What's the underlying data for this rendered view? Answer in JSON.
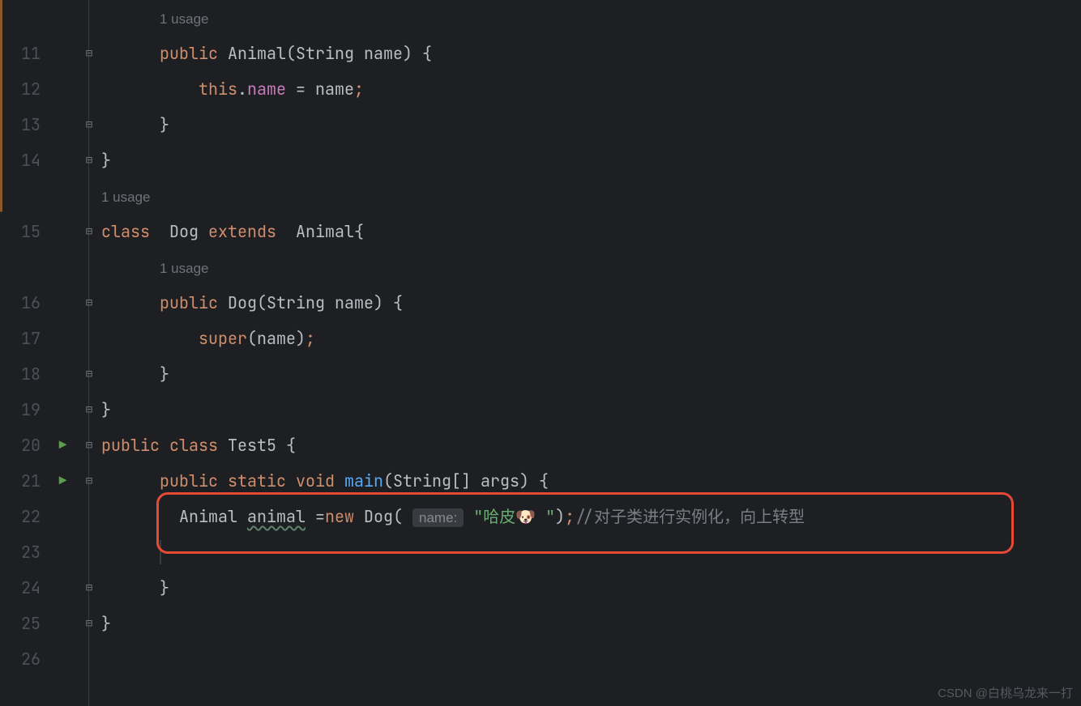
{
  "gutter": {
    "line_numbers": [
      "",
      "11",
      "12",
      "13",
      "14",
      "",
      "15",
      "",
      "16",
      "17",
      "18",
      "19",
      "20",
      "21",
      "22",
      "23",
      "24",
      "25",
      "26"
    ],
    "run_markers": {
      "12": "run",
      "13": "run"
    }
  },
  "hints": {
    "usage_animal_ctor": "1 usage",
    "usage_dog_class": "1 usage",
    "usage_dog_ctor": "1 usage",
    "param_name": "name:"
  },
  "code": {
    "kw_public": "public",
    "kw_class": "class",
    "kw_extends": "extends",
    "kw_static": "static",
    "kw_void": "void",
    "kw_this": "this",
    "kw_super": "super",
    "kw_new": "new",
    "type_animal": "Animal",
    "type_dog": "Dog",
    "type_string": "String",
    "type_stringarr": "String[]",
    "type_test5": "Test5",
    "id_name": "name",
    "id_args": "args",
    "id_animal": "animal",
    "m_main": "main",
    "str_dog": "\"哈皮🐶 \"",
    "comment_upcast": "//对子类进行实例化，向上转型",
    "lbrace": "{",
    "rbrace": "}",
    "lparen": "(",
    "rparen": ")",
    "semi": ";",
    "dot": ".",
    "eq": "=",
    "sp": " "
  },
  "watermark": "CSDN @白桃乌龙来一打"
}
